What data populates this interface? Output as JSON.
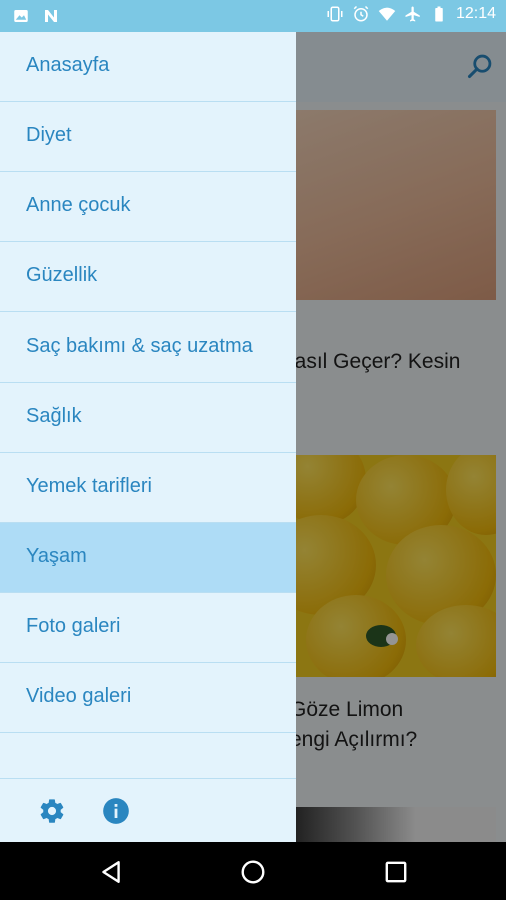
{
  "status_bar": {
    "time": "12:14",
    "background": "#7cc8e4",
    "icons_left": [
      "image-icon",
      "n-notification-icon"
    ],
    "icons_right": [
      "vibrate-icon",
      "alarm-icon",
      "wifi-icon",
      "airplane-mode-icon",
      "battery-icon"
    ]
  },
  "drawer": {
    "items": [
      {
        "label": "Anasayfa",
        "active": false
      },
      {
        "label": "Diyet",
        "active": false
      },
      {
        "label": "Anne çocuk",
        "active": false
      },
      {
        "label": "Güzellik",
        "active": false
      },
      {
        "label": "Saç bakımı & saç uzatma",
        "active": false
      },
      {
        "label": "Sağlık",
        "active": false
      },
      {
        "label": "Yemek tarifleri",
        "active": false
      },
      {
        "label": "Yaşam",
        "active": true
      },
      {
        "label": "Foto galeri",
        "active": false
      },
      {
        "label": "Video galeri",
        "active": false
      }
    ],
    "footer_icons": [
      "gear-icon",
      "info-icon"
    ],
    "colors": {
      "background": "#e3f3fc",
      "active": "#aedcf6",
      "text": "#2a86c0",
      "divider": "#b9def2"
    }
  },
  "background_feed": {
    "cards": [
      {
        "title": "lasıl Geçer? Kesin"
      },
      {
        "title_lines": [
          "Göze Limon",
          "engi Açılırmı?"
        ]
      }
    ]
  },
  "nav_bar": {
    "buttons": [
      "back-icon",
      "home-icon",
      "recents-icon"
    ]
  }
}
